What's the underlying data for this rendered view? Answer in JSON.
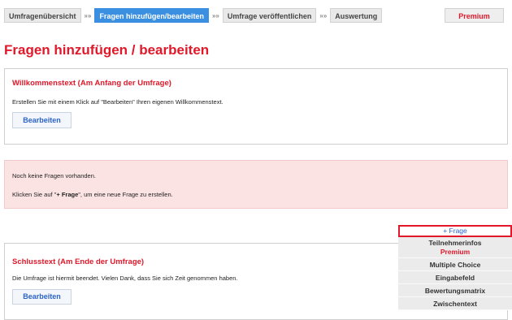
{
  "nav": {
    "steps": [
      "Umfragenübersicht",
      "Fragen hinzufügen/bearbeiten",
      "Umfrage veröffentlichen",
      "Auswertung"
    ],
    "separator": "»»",
    "premium": "Premium"
  },
  "page_title": "Fragen hinzufügen / bearbeiten",
  "welcome": {
    "title": "Willkommenstext (Am Anfang der Umfrage)",
    "text": "Erstellen Sie mit einem Klick auf \"Bearbeiten\" Ihren eigenen Willkommenstext.",
    "button": "Bearbeiten"
  },
  "alert": {
    "line1": "Noch keine Fragen vorhanden.",
    "line2_prefix": "Klicken Sie auf \"",
    "line2_bold": "+ Frage",
    "line2_suffix": "\", um eine neue Frage zu erstellen."
  },
  "closing": {
    "title": "Schlusstext (Am Ende der Umfrage)",
    "text": "Die Umfrage ist hiermit beendet. Vielen Dank, dass Sie sich Zeit genommen haben.",
    "button": "Bearbeiten"
  },
  "dropdown": {
    "add": "+ Frage",
    "participant": "Teilnehmerinfos",
    "participant_badge": "Premium",
    "items": [
      "Multiple Choice",
      "Eingabefeld",
      "Bewertungsmatrix",
      "Zwischentext"
    ]
  },
  "colors": {
    "accent_red": "#e0182a",
    "active_blue": "#3b8fe0",
    "link_blue": "#2b63c9",
    "alert_bg": "#fbe3e3"
  }
}
